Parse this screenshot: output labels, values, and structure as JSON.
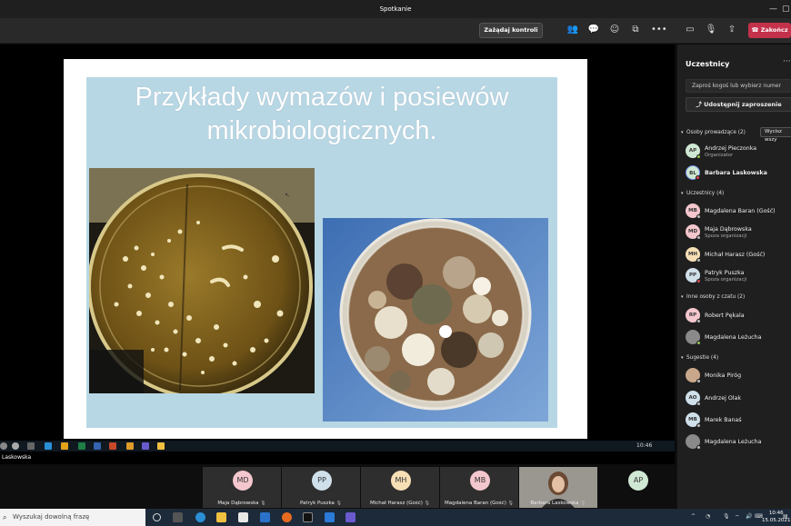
{
  "window": {
    "title": "Spotkanie"
  },
  "toolbar": {
    "control_label": "Zażądaj kontroli",
    "end_label": "Zakończ"
  },
  "slide": {
    "title_line1": "Przykłady wymazów i posiewów",
    "title_line2": "mikrobiologicznych."
  },
  "remote": {
    "time": "10:46",
    "presenter": "Laskowska"
  },
  "strip": {
    "tiles": [
      {
        "initials": "MD",
        "name": "Maja Dąbrowska",
        "color": "#f4c6cd"
      },
      {
        "initials": "PP",
        "name": "Patryk Puszka",
        "color": "#cfe0ea"
      },
      {
        "initials": "MH",
        "name": "Michał Harasz (Gość)",
        "color": "#f6dfb5"
      },
      {
        "initials": "MB",
        "name": "Magdalena Baran (Gość)",
        "color": "#f4c6cd"
      },
      {
        "initials": "",
        "name": "Barbara Laskowska",
        "color": "#6b6a67"
      },
      {
        "initials": "AP",
        "name": "",
        "color": "#cfe8d4"
      }
    ]
  },
  "sidebar": {
    "title": "Uczestnicy",
    "search_placeholder": "Zaproś kogoś lub wybierz numer",
    "share_label": "Udostępnij zaproszenie",
    "mute_all": "Wycisz wszy",
    "sections": {
      "presenters": "Osoby prowadzące (2)",
      "attendees": "Uczestnicy (4)",
      "chat": "Inne osoby z czatu (2)",
      "suggestions": "Sugestie (4)"
    },
    "presenters": [
      {
        "initials": "AP",
        "name": "Andrzej Pieczonka",
        "role": "Organizator",
        "color": "#cfe8d4"
      },
      {
        "initials": "BL",
        "name": "Barbara Laskowska",
        "role": "",
        "color": "#cfe8d4"
      }
    ],
    "attendees": [
      {
        "initials": "MB",
        "name": "Magdalena Baran (Gość)",
        "role": "",
        "color": "#f4c6cd"
      },
      {
        "initials": "MD",
        "name": "Maja Dąbrowska",
        "role": "Spoza organizacji",
        "color": "#f4c6cd"
      },
      {
        "initials": "MH",
        "name": "Michał Harasz (Gość)",
        "role": "",
        "color": "#f6dfb5"
      },
      {
        "initials": "PP",
        "name": "Patryk Puszka",
        "role": "Spoza organizacji",
        "color": "#cfe0ea"
      }
    ],
    "chat": [
      {
        "initials": "RP",
        "name": "Robert Pękala",
        "role": "",
        "color": "#f4c6cd"
      },
      {
        "initials": "",
        "name": "Magdalena Leżucha",
        "role": "",
        "color": "#8a8a8a"
      }
    ],
    "suggestions": [
      {
        "initials": "",
        "name": "Monika Piróg",
        "role": "",
        "color": "#c9a78a"
      },
      {
        "initials": "AO",
        "name": "Andrzej Olak",
        "role": "",
        "color": "#cfe0ea"
      },
      {
        "initials": "MB",
        "name": "Marek Banaś",
        "role": "",
        "color": "#cfe0ea"
      },
      {
        "initials": "",
        "name": "Magdalena Leżucha",
        "role": "",
        "color": "#8a8a8a"
      }
    ]
  },
  "taskbar": {
    "search_placeholder": "Wyszukaj dowolną frazę",
    "time": "10:46",
    "date": "15.05.2021"
  }
}
